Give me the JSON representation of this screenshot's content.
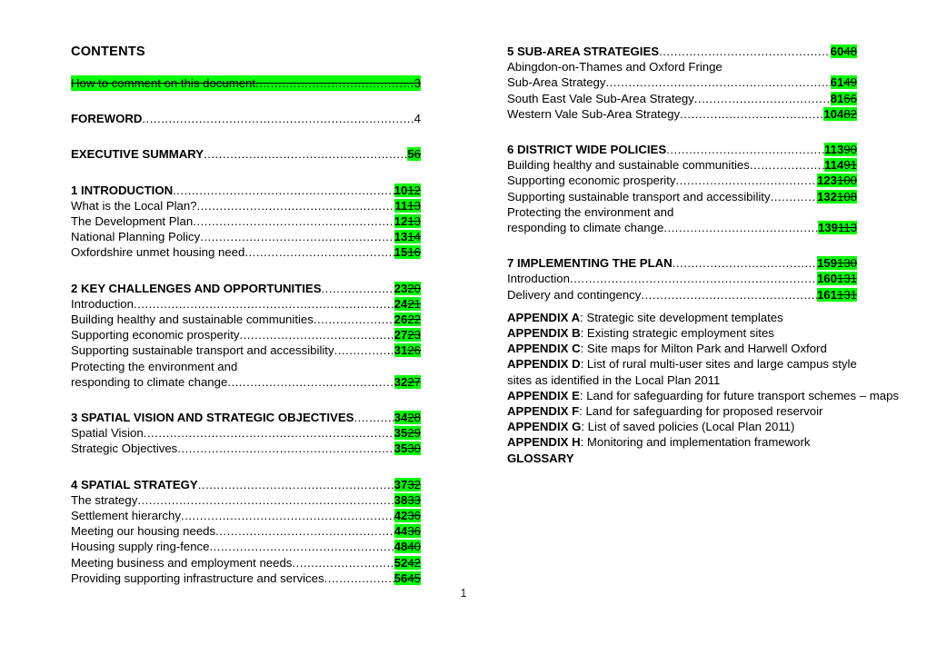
{
  "document": {
    "page_number": "1",
    "highlight_color": "#00ff00"
  },
  "left_column": {
    "title": "CONTENTS",
    "entries": [
      {
        "label": "How to comment on this document",
        "page_new": "",
        "page_old": "",
        "page_plain": "3",
        "style": "deleted-line",
        "bold": false
      },
      {
        "label": "FOREWORD ",
        "page_new": "",
        "page_old": "",
        "page_plain": "4",
        "style": "plain",
        "bold": true
      },
      {
        "label": "EXECUTIVE SUMMARY",
        "page_new": "5",
        "page_old": "6",
        "page_plain": "",
        "style": "revised",
        "bold": true
      },
      {
        "label": "1 INTRODUCTION",
        "page_new": "10",
        "page_old": "12",
        "page_plain": "",
        "style": "revised",
        "bold": true
      },
      {
        "label": "What is the Local Plan?",
        "page_new": "11",
        "page_old": "13",
        "page_plain": "",
        "style": "revised",
        "bold": false
      },
      {
        "label": "The Development Plan",
        "page_new": "12",
        "page_old": "13",
        "page_plain": "",
        "style": "revised",
        "bold": false
      },
      {
        "label": "National Planning Policy",
        "page_new": "13",
        "page_old": "14",
        "page_plain": "",
        "style": "revised",
        "bold": false
      },
      {
        "label": "Oxfordshire unmet housing need",
        "page_new": "15",
        "page_old": "16",
        "page_plain": "",
        "style": "revised",
        "bold": false
      },
      {
        "label": "2 KEY CHALLENGES AND OPPORTUNITIES ",
        "page_new": "23",
        "page_old": "20",
        "page_plain": "",
        "style": "revised",
        "bold": true
      },
      {
        "label": "Introduction ",
        "page_new": "24",
        "page_old": "21",
        "page_plain": "",
        "style": "revised",
        "bold": false
      },
      {
        "label": "Building healthy and sustainable communities ",
        "page_new": "26",
        "page_old": "22",
        "page_plain": "",
        "style": "revised",
        "bold": false
      },
      {
        "label": "Supporting economic prosperity ",
        "page_new": "27",
        "page_old": "23",
        "page_plain": "",
        "style": "revised",
        "bold": false
      },
      {
        "label": "Supporting sustainable transport and accessibility ",
        "page_new": "31",
        "page_old": "26",
        "page_plain": "",
        "style": "revised",
        "bold": false
      },
      {
        "label": "Protecting the environment and",
        "continuation_label": "responding to climate change ",
        "page_new": "32",
        "page_old": "27",
        "page_plain": "",
        "style": "revised-wrapped",
        "bold": false
      },
      {
        "label": "3 SPATIAL VISION AND STRATEGIC OBJECTIVES ",
        "page_new": "34",
        "page_old": "28",
        "page_plain": "",
        "style": "revised",
        "bold": true
      },
      {
        "label": "Spatial Vision ",
        "page_new": "35",
        "page_old": "29",
        "page_plain": "",
        "style": "revised",
        "bold": false
      },
      {
        "label": "Strategic Objectives ",
        "page_new": "35",
        "page_old": "30",
        "page_plain": "",
        "style": "revised",
        "bold": false
      },
      {
        "label": "4 SPATIAL STRATEGY",
        "page_new": "37",
        "page_old": "32",
        "page_plain": "",
        "style": "revised",
        "bold": true
      },
      {
        "label": "The strategy ",
        "page_new": "38",
        "page_old": "33",
        "page_plain": "",
        "style": "revised",
        "bold": false
      },
      {
        "label": "Settlement hierarchy ",
        "page_new": "42",
        "page_old": "36",
        "page_plain": "",
        "style": "revised",
        "bold": false
      },
      {
        "label": "Meeting our housing needs ",
        "page_new": "44",
        "page_old": "36",
        "page_plain": "",
        "style": "revised",
        "bold": false
      },
      {
        "label": "Housing supply ring-fence",
        "page_new": "48",
        "page_old": "40",
        "page_plain": "",
        "style": "revised",
        "bold": false
      },
      {
        "label": "Meeting business and employment needs ",
        "page_new": "52",
        "page_old": "42",
        "page_plain": "",
        "style": "revised",
        "bold": false
      },
      {
        "label": "Providing supporting infrastructure and services ",
        "page_new": "56",
        "page_old": "45",
        "page_plain": "",
        "style": "revised",
        "bold": false
      }
    ]
  },
  "right_column": {
    "entries": [
      {
        "label": "5 SUB-AREA STRATEGIES",
        "page_new": "60",
        "page_old": "48",
        "page_plain": "",
        "style": "revised",
        "bold": true
      },
      {
        "label": "Abingdon-on-Thames and Oxford Fringe",
        "continuation_label": "Sub-Area Strategy",
        "page_new": "61",
        "page_old": "49",
        "page_plain": "",
        "style": "revised-wrapped",
        "bold": false
      },
      {
        "label": "South East Vale Sub-Area Strategy ",
        "page_new": "81",
        "page_old": "66",
        "page_plain": "",
        "style": "revised",
        "bold": false
      },
      {
        "label": "Western Vale Sub-Area Strategy ",
        "page_new": "104",
        "page_old": "82",
        "page_plain": "",
        "style": "revised",
        "bold": false
      },
      {
        "label": "6 DISTRICT WIDE POLICIES",
        "page_new": "113",
        "page_old": "90",
        "page_plain": "",
        "style": "revised",
        "bold": true
      },
      {
        "label": "Building healthy and sustainable communities ",
        "page_new": "114",
        "page_old": "91",
        "page_plain": "",
        "style": "revised",
        "bold": false
      },
      {
        "label": "Supporting economic prosperity ",
        "page_new": "123",
        "page_old": "100",
        "page_plain": "",
        "style": "revised",
        "bold": false
      },
      {
        "label": "Supporting sustainable transport and accessibility ",
        "page_new": "132",
        "page_old": "108",
        "page_plain": "",
        "style": "revised",
        "bold": false
      },
      {
        "label": "Protecting the environment and",
        "continuation_label": "responding to climate change ",
        "page_new": "139",
        "page_old": "113",
        "page_plain": "",
        "style": "revised-wrapped",
        "bold": false
      },
      {
        "label": "7 IMPLEMENTING THE PLAN ",
        "page_new": "159",
        "page_old": "130",
        "page_plain": "",
        "style": "revised",
        "bold": true
      },
      {
        "label": "Introduction ",
        "page_new": "160",
        "page_old": "131",
        "page_plain": "",
        "style": "revised",
        "bold": false
      },
      {
        "label": "Delivery and contingency ",
        "page_new": "161",
        "page_old": "131",
        "page_plain": "",
        "style": "revised",
        "bold": false
      }
    ],
    "appendices": [
      {
        "key": "APPENDIX A",
        "text": ": Strategic site development templates",
        "continuation": ""
      },
      {
        "key": "APPENDIX B",
        "text": ": Existing strategic employment sites",
        "continuation": ""
      },
      {
        "key": "APPENDIX C",
        "text": ": Site maps for Milton Park and Harwell Oxford",
        "continuation": ""
      },
      {
        "key": "APPENDIX D",
        "text": ": List of rural multi-user sites and large campus style",
        "continuation": "sites as identified in the Local Plan 2011"
      },
      {
        "key": "APPENDIX E",
        "text": ": Land for safeguarding for future transport schemes – maps",
        "continuation": ""
      },
      {
        "key": "APPENDIX F",
        "text": ": Land for safeguarding for proposed reservoir",
        "continuation": ""
      },
      {
        "key": "APPENDIX G",
        "text": ": List of saved policies (Local Plan 2011)",
        "continuation": ""
      },
      {
        "key": "APPENDIX H",
        "text": ": Monitoring and implementation framework",
        "continuation": ""
      }
    ],
    "glossary_label": "GLOSSARY"
  }
}
